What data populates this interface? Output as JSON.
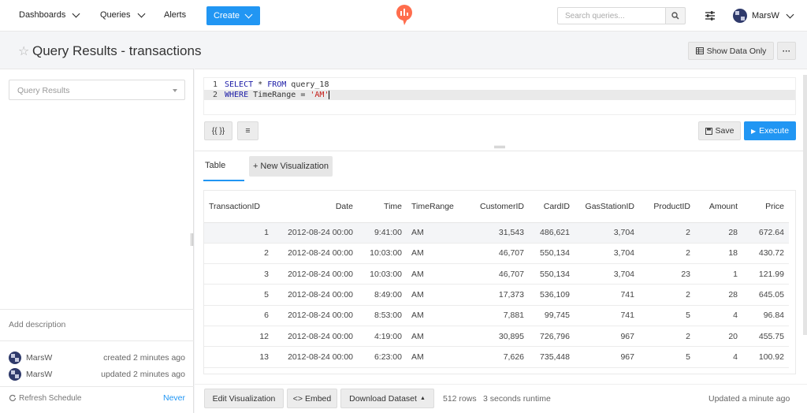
{
  "nav": {
    "dashboards": "Dashboards",
    "queries": "Queries",
    "alerts": "Alerts",
    "create": "Create",
    "search_placeholder": "Search queries...",
    "username": "MarsW",
    "logo_color": "#ff6d4d"
  },
  "header": {
    "title": "Query Results - transactions",
    "show_data_only": "Show Data Only",
    "more": "···"
  },
  "sidebar": {
    "data_source_placeholder": "Query Results",
    "add_description": "Add description",
    "created": {
      "user": "MarsW",
      "text": "created 2 minutes ago"
    },
    "updated": {
      "user": "MarsW",
      "text": "updated 2 minutes ago"
    },
    "refresh_label": "Refresh Schedule",
    "refresh_value": "Never"
  },
  "editor": {
    "lines": [
      {
        "num": "1",
        "kw1": "SELECT",
        "mid1": " * ",
        "kw2": "FROM",
        "rest": " query_18"
      },
      {
        "num": "2",
        "kw1": "WHERE",
        "mid1": " TimeRange = ",
        "str": "'AM'"
      }
    ],
    "params_btn": "{{ }}",
    "format_btn": "≡",
    "save": "Save",
    "execute": "Execute"
  },
  "results": {
    "tab_table": "Table",
    "tab_new_vis": "+ New Visualization",
    "columns": [
      "TransactionID",
      "Date",
      "Time",
      "TimeRange",
      "CustomerID",
      "CardID",
      "GasStationID",
      "ProductID",
      "Amount",
      "Price"
    ],
    "rows": [
      [
        "1",
        "2012-08-24 00:00",
        "9:41:00",
        "AM",
        "31,543",
        "486,621",
        "3,704",
        "2",
        "28",
        "672.64"
      ],
      [
        "2",
        "2012-08-24 00:00",
        "10:03:00",
        "AM",
        "46,707",
        "550,134",
        "3,704",
        "2",
        "18",
        "430.72"
      ],
      [
        "3",
        "2012-08-24 00:00",
        "10:03:00",
        "AM",
        "46,707",
        "550,134",
        "3,704",
        "23",
        "1",
        "121.99"
      ],
      [
        "5",
        "2012-08-24 00:00",
        "8:49:00",
        "AM",
        "17,373",
        "536,109",
        "741",
        "2",
        "28",
        "645.05"
      ],
      [
        "6",
        "2012-08-24 00:00",
        "8:53:00",
        "AM",
        "7,881",
        "99,745",
        "741",
        "5",
        "4",
        "96.84"
      ],
      [
        "12",
        "2012-08-24 00:00",
        "4:19:00",
        "AM",
        "30,895",
        "726,796",
        "967",
        "2",
        "20",
        "455.75"
      ],
      [
        "13",
        "2012-08-24 00:00",
        "6:23:00",
        "AM",
        "7,626",
        "735,448",
        "967",
        "5",
        "4",
        "100.92"
      ]
    ],
    "edit_vis": "Edit Visualization",
    "embed": "<> Embed",
    "download": "Download Dataset",
    "row_count": "512 rows",
    "runtime": "3 seconds runtime",
    "updated": "Updated a minute ago"
  },
  "colors": {
    "accent": "#2196f3",
    "brand": "#ff6d4d"
  }
}
